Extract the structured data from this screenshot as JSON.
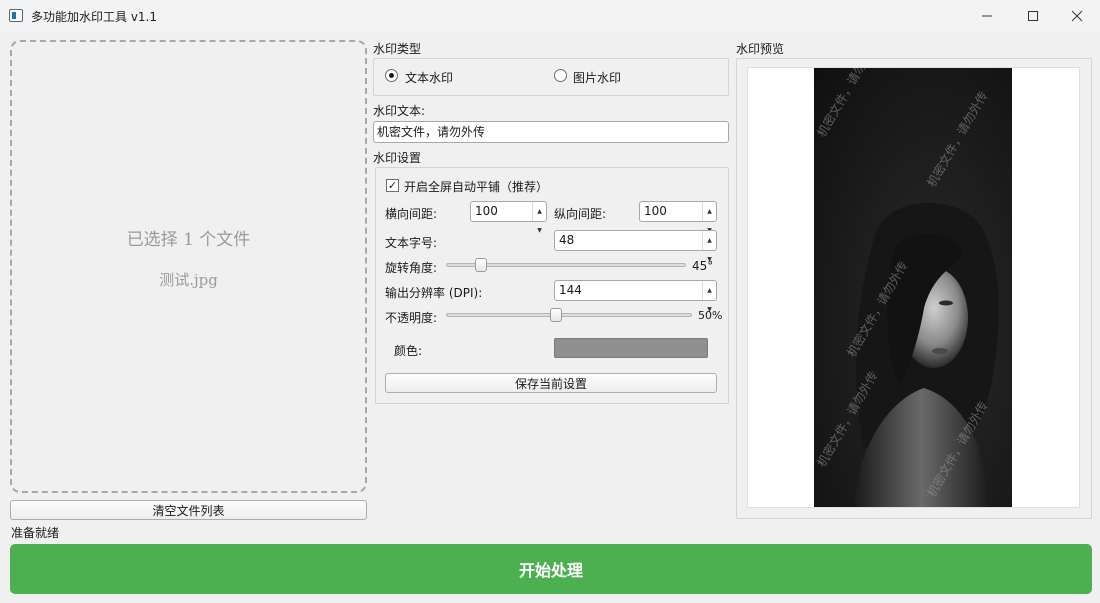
{
  "window": {
    "title": "多功能加水印工具 v1.1"
  },
  "files": {
    "count_text": "已选择 1 个文件",
    "file_name": "测试.jpg",
    "clear_label": "清空文件列表"
  },
  "status": "准备就绪",
  "start_label": "开始处理",
  "watermark_type": {
    "title": "水印类型",
    "options": [
      "文本水印",
      "图片水印"
    ],
    "selected": "文本水印"
  },
  "watermark_text": {
    "label": "水印文本:",
    "value": "机密文件，请勿外传"
  },
  "settings": {
    "title": "水印设置",
    "tile_label": "开启全屏自动平铺（推荐）",
    "tile_checked": true,
    "h_spacing_label": "横向间距:",
    "h_spacing_value": "100",
    "v_spacing_label": "纵向间距:",
    "v_spacing_value": "100",
    "font_size_label": "文本字号:",
    "font_size_value": "48",
    "rotation_label": "旋转角度:",
    "rotation_value": "45°",
    "rotation_degrees": 45,
    "dpi_label": "输出分辨率 (DPI):",
    "dpi_value": "144",
    "opacity_label": "不透明度:",
    "opacity_value": "50%",
    "opacity_percent": 50,
    "color_label": "颜色:",
    "color_hex": "#8f8f8f",
    "save_label": "保存当前设置"
  },
  "preview": {
    "title": "水印预览",
    "watermark_sample": "机密文件，请勿外传"
  },
  "colors": {
    "start_button": "#4caf50",
    "background": "#f0f0f0"
  }
}
